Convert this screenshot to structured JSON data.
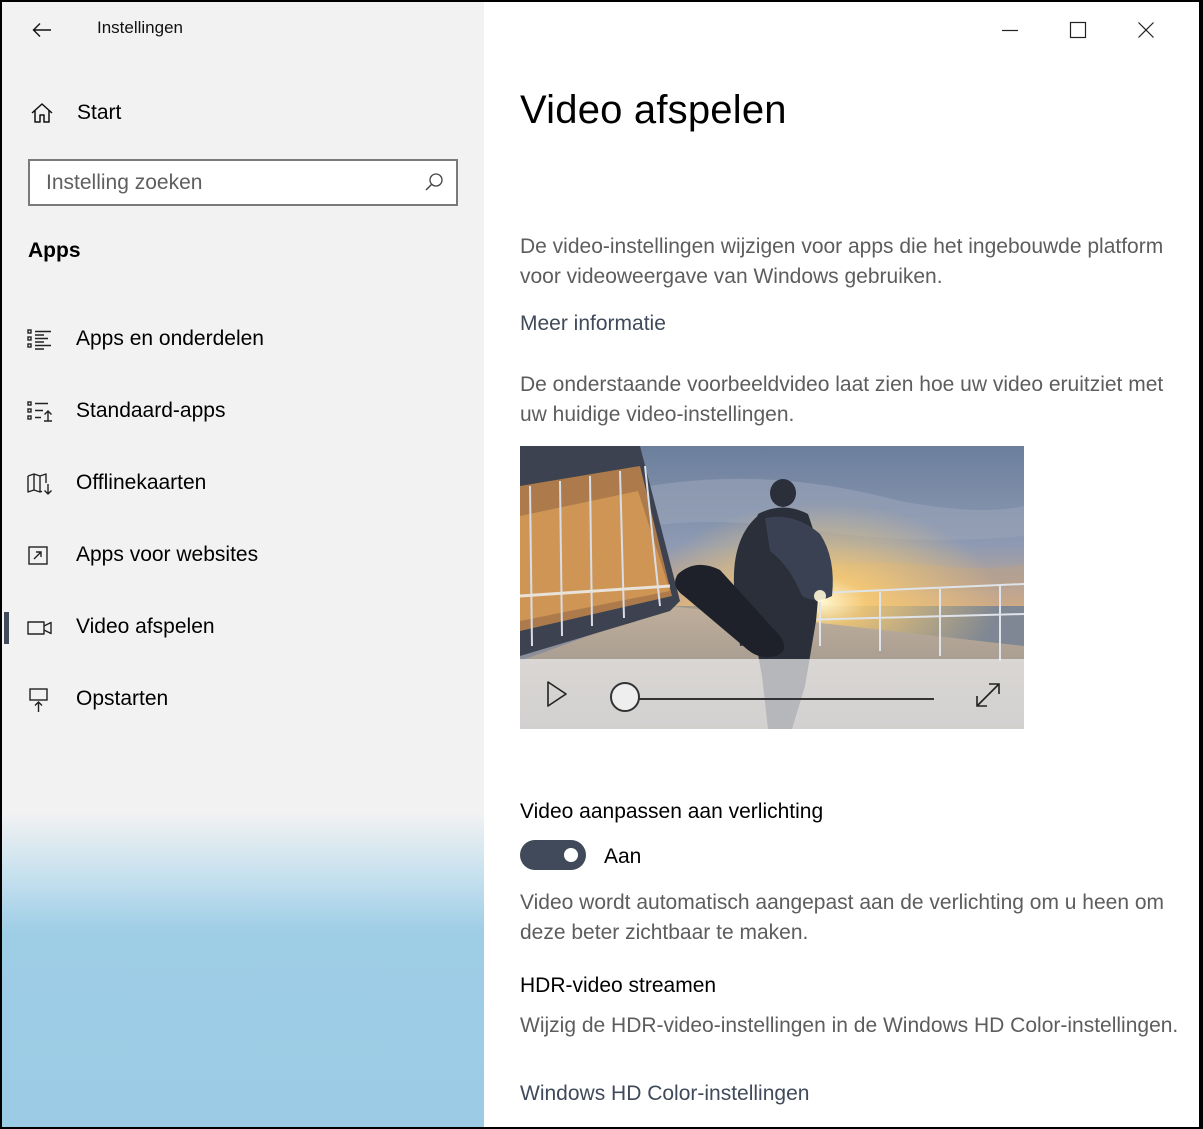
{
  "window": {
    "title": "Instellingen"
  },
  "sidebar": {
    "start_label": "Start",
    "search_placeholder": "Instelling zoeken",
    "section_heading": "Apps",
    "items": [
      {
        "label": "Apps en onderdelen",
        "icon": "apps-list-icon"
      },
      {
        "label": "Standaard-apps",
        "icon": "default-apps-icon"
      },
      {
        "label": "Offlinekaarten",
        "icon": "offline-map-icon"
      },
      {
        "label": "Apps voor websites",
        "icon": "apps-websites-icon"
      },
      {
        "label": "Video afspelen",
        "icon": "video-camera-icon",
        "active": true
      },
      {
        "label": "Opstarten",
        "icon": "startup-icon"
      }
    ]
  },
  "main": {
    "title": "Video afspelen",
    "description": "De video-instellingen wijzigen voor apps die het ingebouwde platform voor videoweergave van Windows gebruiken.",
    "more_info_link": "Meer informatie",
    "preview_description": "De onderstaande voorbeeldvideo laat zien hoe uw video eruitziet met uw huidige video-instellingen.",
    "video": {
      "progress": 0
    },
    "lighting": {
      "title": "Video aanpassen aan verlichting",
      "toggle_state": "Aan",
      "toggle_on": true,
      "description": "Video wordt automatisch aangepast aan de verlichting om u heen om deze beter zichtbaar te maken."
    },
    "hdr": {
      "title": "HDR-video streamen",
      "description": "Wijzig de HDR-video-instellingen in de Windows HD Color-instellingen.",
      "link": "Windows HD Color-instellingen"
    }
  },
  "colors": {
    "accent": "#404a5a",
    "sidebar_bg": "#f2f2f2",
    "secondary_text": "#5d5d5d"
  }
}
